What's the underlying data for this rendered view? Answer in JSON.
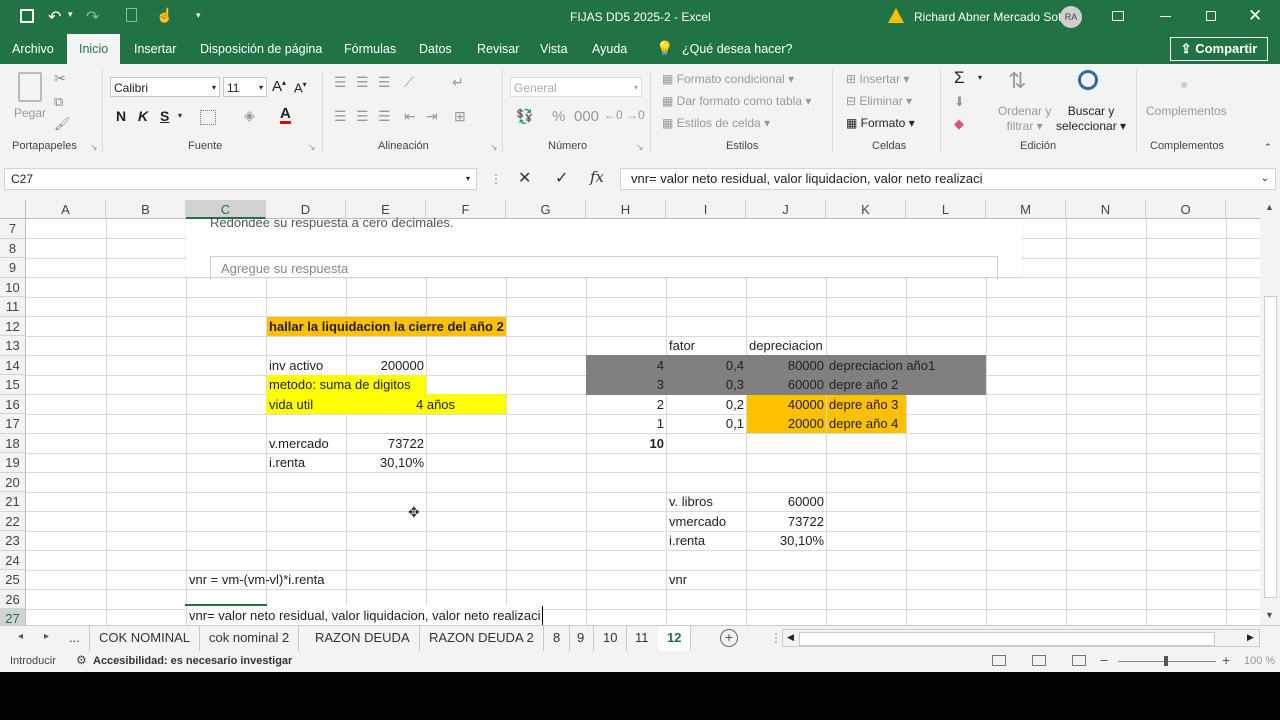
{
  "titlebar": {
    "file_title": "FIJAS DD5 2025-2  -  Excel",
    "user": "Richard Abner Mercado Soto",
    "avatar_initials": "RA"
  },
  "menu_tabs": [
    "Archivo",
    "Inicio",
    "Insertar",
    "Disposición de página",
    "Fórmulas",
    "Datos",
    "Revisar",
    "Vista",
    "Ayuda"
  ],
  "tell_me": "¿Qué desea hacer?",
  "share_label": "Compartir",
  "ribbon": {
    "paste": "Pegar",
    "font_name": "Calibri",
    "font_size": "11",
    "bold": "N",
    "italic": "K",
    "underline": "S",
    "number_format": "General",
    "cond_format": "Formato condicional",
    "table_format": "Dar formato como tabla",
    "cell_styles": "Estilos de celda",
    "insert": "Insertar",
    "delete": "Eliminar",
    "format": "Formato",
    "sort_filter_1": "Ordenar y",
    "sort_filter_2": "filtrar",
    "find_1": "Buscar y",
    "find_2": "seleccionar",
    "addins": "Complementos",
    "groups": {
      "clipboard": "Portapapeles",
      "font": "Fuente",
      "align": "Alineación",
      "number": "Número",
      "styles": "Estilos",
      "cells": "Celdas",
      "edit": "Edición",
      "addins": "Complementos"
    }
  },
  "formula_bar": {
    "name_box": "C27",
    "content": "vnr= valor neto residual, valor liquidacion, valor neto realizaci"
  },
  "columns": [
    "A",
    "B",
    "C",
    "D",
    "E",
    "F",
    "G",
    "H",
    "I",
    "J",
    "K",
    "L",
    "M",
    "N",
    "O"
  ],
  "rows": [
    "7",
    "8",
    "9",
    "10",
    "11",
    "12",
    "13",
    "14",
    "15",
    "16",
    "17",
    "18",
    "19",
    "20",
    "21",
    "22",
    "23",
    "24",
    "25",
    "26",
    "27"
  ],
  "overlay": {
    "text1": "Redondee su respuesta a cero decimales.",
    "placeholder": "Agregue su respuesta"
  },
  "cells": {
    "title": "hallar la liquidacion la cierre del año 2",
    "inv_label": "inv activo",
    "inv_value": "200000",
    "metodo": "metodo: suma de digitos",
    "vida_label": "vida util",
    "vida_value": "4 años",
    "vmercado_label": "v.mercado",
    "vmercado_value": "73722",
    "irenta_label": "i.renta",
    "irenta_value": "30,10%",
    "formula_text": "vnr = vm-(vm-vl)*i.renta",
    "editing_text": "vnr= valor neto residual, valor liquidacion, valor neto realizaci",
    "fator_header": "fator",
    "dep_header": "depreciacion",
    "table": [
      {
        "h": "4",
        "i": "0,4",
        "j": "80000",
        "k": "depreciacion año1"
      },
      {
        "h": "3",
        "i": "0,3",
        "j": "60000",
        "k": "depre año  2"
      },
      {
        "h": "2",
        "i": "0,2",
        "j": "40000",
        "k": "depre año 3"
      },
      {
        "h": "1",
        "i": "0,1",
        "j": "20000",
        "k": "depre año 4"
      }
    ],
    "sum": "10",
    "vlibros_label": "v. libros",
    "vlibros_value": "60000",
    "vmercado2_label": "vmercado",
    "vmercado2_value": "73722",
    "irenta2_label": "i.renta",
    "irenta2_value": "30,10%",
    "vnr_label": "vnr"
  },
  "sheet_tabs": [
    "...",
    "COK NOMINAL",
    "cok nominal 2",
    "RAZON DEUDA",
    "RAZON DEUDA 2",
    "8",
    "9",
    "10",
    "11",
    "12"
  ],
  "status": {
    "mode": "Introducir",
    "accessibility": "Accesibilidad: es necesario investigar",
    "zoom": "100 %"
  },
  "colors": {
    "excel_green": "#217346",
    "highlight_orange": "#ffc000",
    "highlight_yellow": "#ffff00",
    "dark_gray": "#808080"
  }
}
